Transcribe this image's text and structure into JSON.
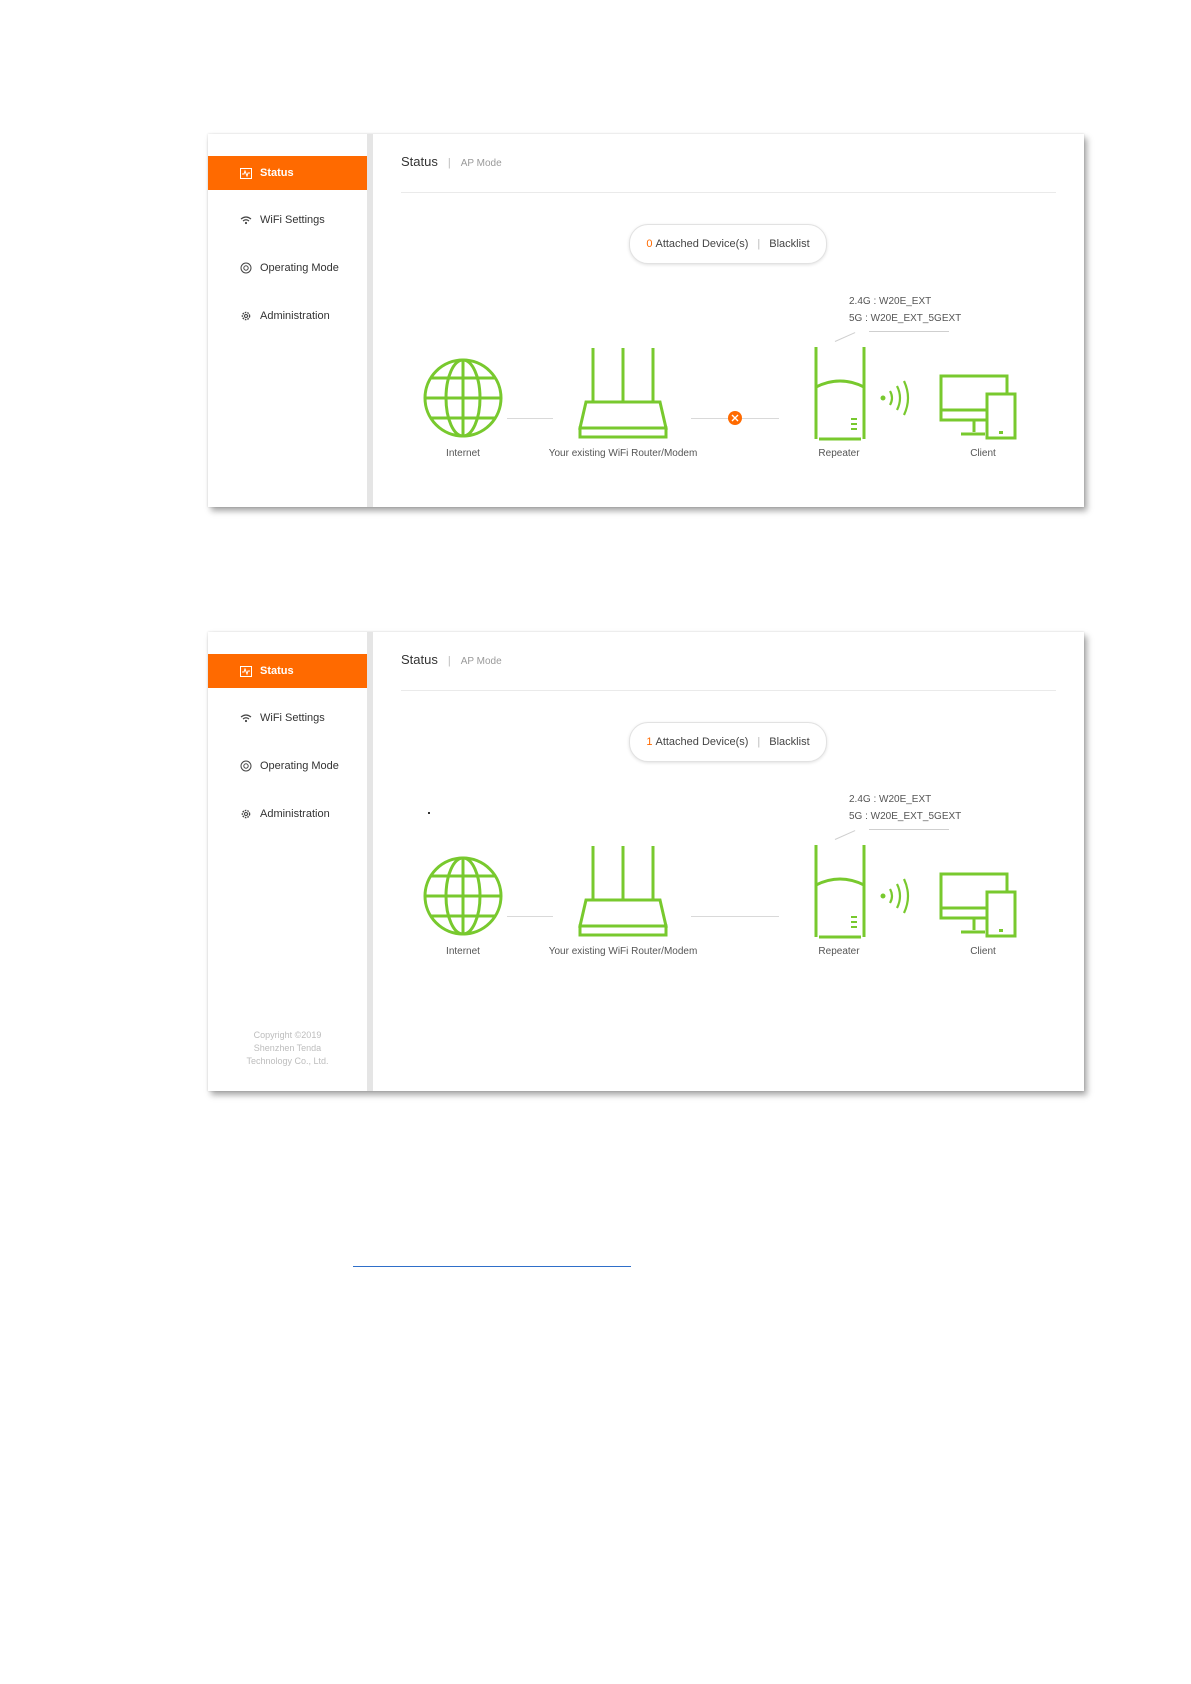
{
  "sidebar": {
    "items": [
      {
        "label": "Status",
        "icon": "status-icon"
      },
      {
        "label": "WiFi Settings",
        "icon": "wifi-icon"
      },
      {
        "label": "Operating Mode",
        "icon": "operating-mode-icon"
      },
      {
        "label": "Administration",
        "icon": "gear-icon"
      }
    ],
    "copyright": [
      "Copyright ©2019",
      "Shenzhen Tenda",
      "Technology Co., Ltd."
    ]
  },
  "header": {
    "title": "Status",
    "separator": "|",
    "mode": "AP Mode"
  },
  "devices": {
    "label": "Attached Device(s)",
    "separator": "|",
    "blacklist": "Blacklist",
    "count_shot1": "0",
    "count_shot2": "1"
  },
  "ssid": {
    "line1": "2.4G :  W20E_EXT",
    "line2": "5G :  W20E_EXT_5GEXT"
  },
  "topology": {
    "internet": "Internet",
    "router": "Your existing WiFi Router/Modem",
    "repeater": "Repeater",
    "client": "Client"
  },
  "colors": {
    "accent": "#ff6a00",
    "device_green": "#78c92e",
    "error": "#ff6a00"
  }
}
